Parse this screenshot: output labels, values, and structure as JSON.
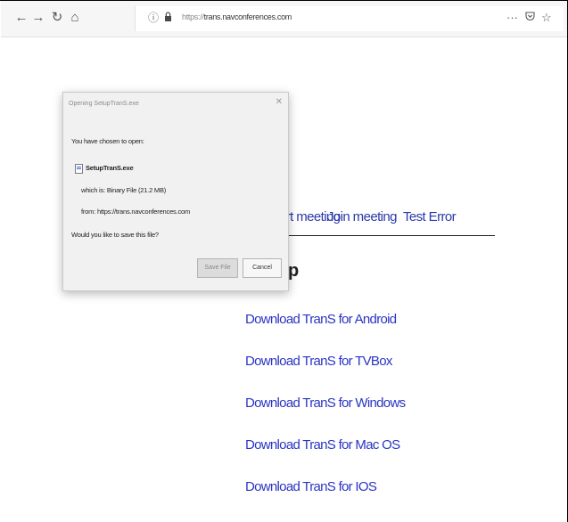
{
  "browser": {
    "url_protocol": "https://",
    "url_host": "trans.navconferences.com",
    "menu_glyph": "···"
  },
  "page": {
    "nav": [
      "Start meeting",
      "Join meeting",
      "Test Error"
    ],
    "heading_fragment": "p",
    "downloads": [
      "Download TranS for Android",
      "Download TranS for TVBox",
      "Download TranS for Windows",
      "Download TranS for Mac OS",
      "Download TranS for IOS"
    ]
  },
  "dialog": {
    "title": "Opening SetupTranS.exe",
    "intro": "You have chosen to open:",
    "file_name": "SetupTranS.exe",
    "type_line": "which is: Binary File (21.2 MB)",
    "from_line": "from: https://trans.navconferences.com",
    "question": "Would you like to save this file?",
    "save_label": "Save File",
    "cancel_label": "Cancel"
  }
}
